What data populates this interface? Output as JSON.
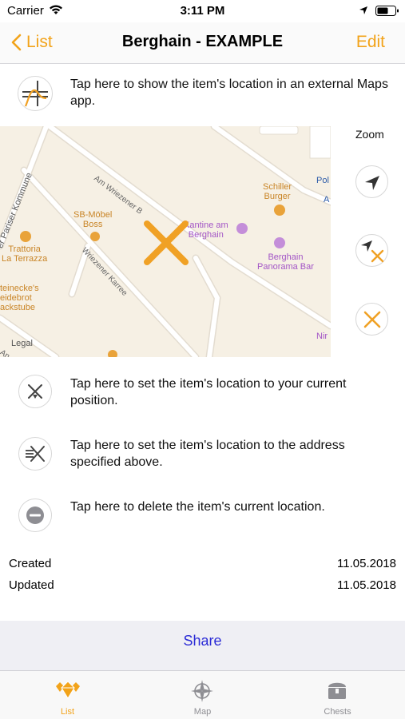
{
  "status_bar": {
    "carrier": "Carrier",
    "time": "3:11 PM"
  },
  "nav": {
    "back_label": "List",
    "title": "Berghain - EXAMPLE",
    "edit_label": "Edit"
  },
  "location_rows": {
    "external_maps": "Tap here to show the item's location in an external Maps app.",
    "current_position": "Tap here to set the item's location to your current position.",
    "address": "Tap here to set the item's location to the address specified above.",
    "delete": "Tap here to delete the item's current location."
  },
  "map": {
    "labels": {
      "street_pariser": "er Pariser Kommune",
      "street_am_wriezener": "Am Wriezener B",
      "street_wriezener_karree": "Wriezener Karree",
      "poi_sb_moebel": "SB-Möbel\nBoss",
      "poi_kantine": "Kantine am\nBerghain",
      "poi_schiller": "Schiller\nBurger",
      "poi_berghain": "Berghain\nPanorama Bar",
      "poi_trattoria": "Trattoria\nLa Terrazza",
      "poi_steinecke": "teinecke's\neidebrot\nackstube",
      "edge_pol": "Pol",
      "edge_a": "A",
      "edge_nir": "Nir",
      "legal": "Legal",
      "street_an_der": "An der"
    },
    "marker_color": "#f0a125",
    "poi_color": "#c98527",
    "poi_purple": "#a355c6"
  },
  "zoom": {
    "label": "Zoom"
  },
  "dates": {
    "created_label": "Created",
    "created_value": "11.05.2018",
    "updated_label": "Updated",
    "updated_value": "11.05.2018"
  },
  "share": {
    "label": "Share"
  },
  "tabs": [
    {
      "label": "List",
      "icon": "diamonds-icon",
      "active": true
    },
    {
      "label": "Map",
      "icon": "compass-icon",
      "active": false
    },
    {
      "label": "Chests",
      "icon": "chest-icon",
      "active": false
    }
  ],
  "colors": {
    "accent": "#f2a31a",
    "link": "#2b2bd6"
  }
}
